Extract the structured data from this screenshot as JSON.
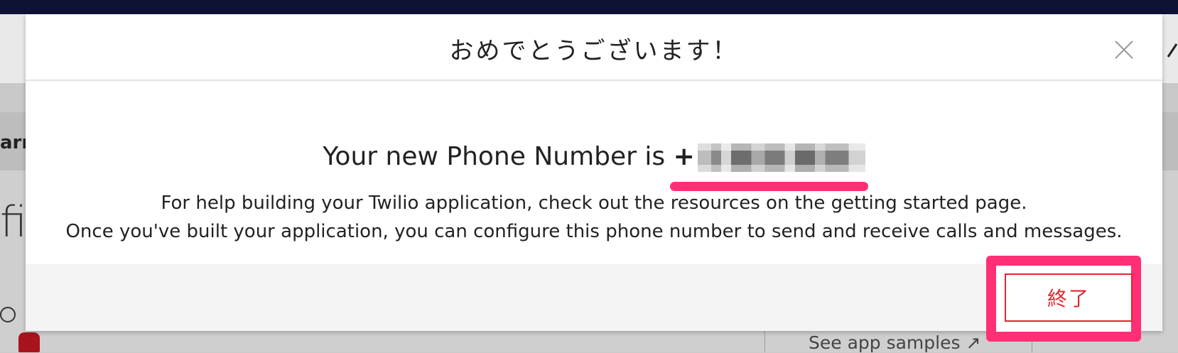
{
  "modal": {
    "title": "おめでとうございます！",
    "phone_prefix": "Your new Phone Number is ",
    "phone_plus": "+",
    "body_line1": "For help building your Twilio application, check out the resources on the getting started page.",
    "body_line2": "Once you've built your application, you can configure this phone number to send and receive calls and messages.",
    "finish_button_label": "終了",
    "close_icon": "close-icon"
  },
  "background": {
    "fragment_1": "arn",
    "fragment_2": "fir",
    "link": "See app samples ↗"
  },
  "colors": {
    "topbar": "#0d1233",
    "annotation": "#ff2f75",
    "finish_button": "#e0262f"
  }
}
